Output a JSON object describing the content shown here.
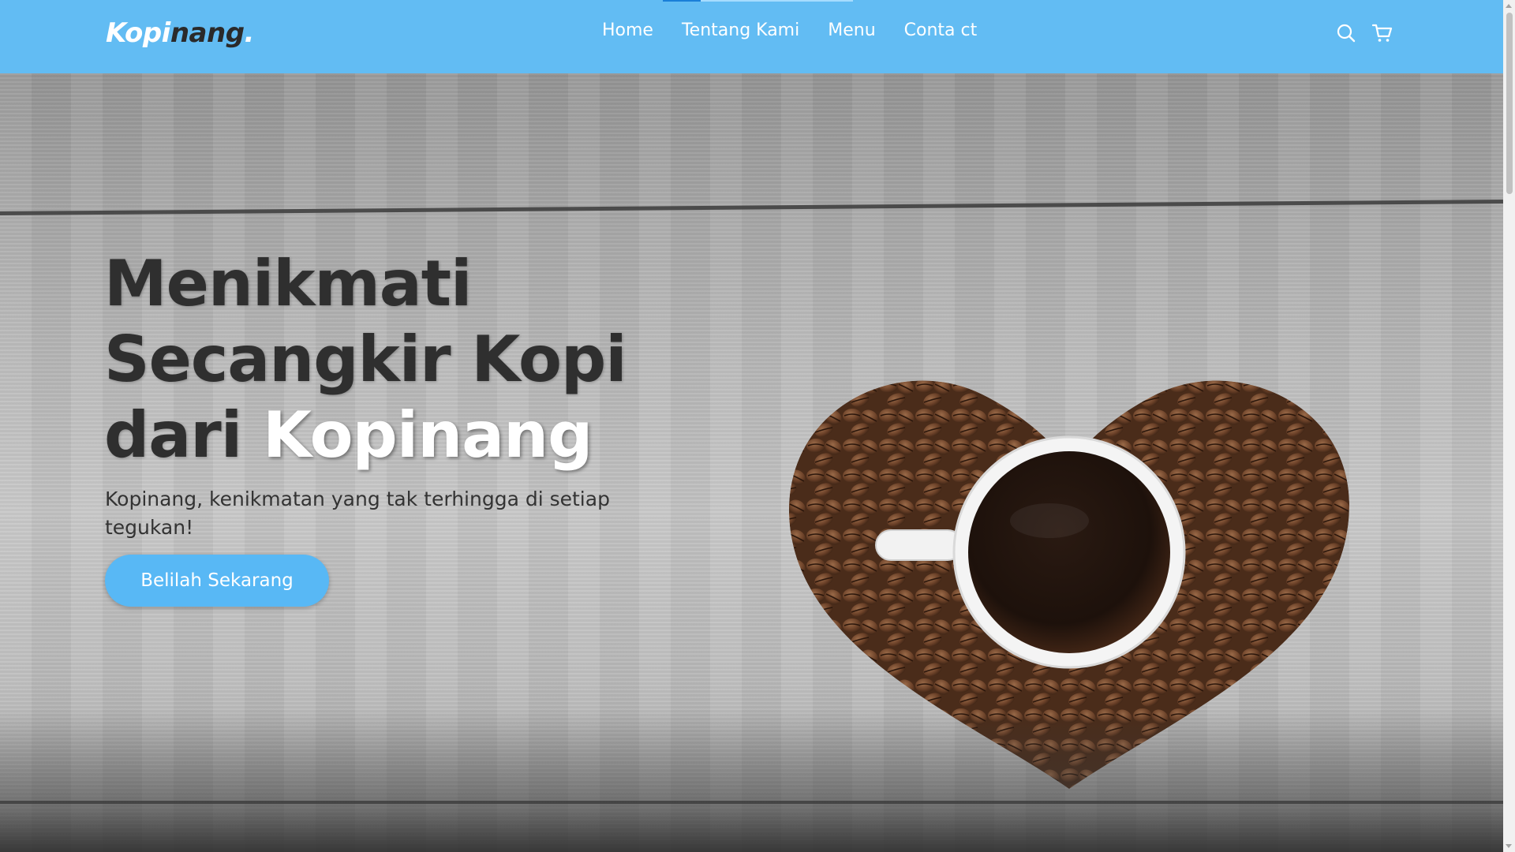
{
  "navbar": {
    "logo": {
      "part1": "Kopi",
      "part2": "nang",
      "dot": "."
    },
    "menu": [
      {
        "label": "Home"
      },
      {
        "label": "Tentang Kami"
      },
      {
        "label": "Menu"
      },
      {
        "label": "Conta ct"
      }
    ],
    "icons": [
      "search-icon",
      "shopping-cart-icon"
    ]
  },
  "hero": {
    "title_line1": "Menikmati",
    "title_line2": "Secangkir Kopi",
    "title_line3_prefix": "dari ",
    "title_highlight": "Kopinang",
    "subtitle": "Kopinang, kenikmatan yang tak terhingga di setiap tegukan!",
    "cta_label": "Belilah Sekarang"
  },
  "colors": {
    "navbar_bg": "#62bcf3",
    "accent": "#58b8f5",
    "title_text": "#2f2f2f",
    "highlight_text": "#ffffff"
  }
}
